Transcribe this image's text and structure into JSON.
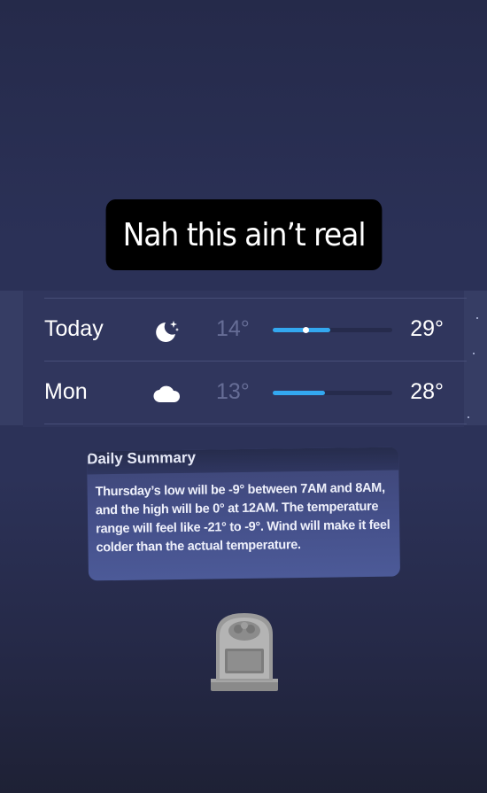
{
  "caption": {
    "text": "Nah this ain’t real"
  },
  "forecast": [
    {
      "day": "Today",
      "icon": "moon-stars-icon",
      "low": "14°",
      "high": "29°",
      "bar_start": 0.0,
      "bar_end": 0.48,
      "current": 0.28
    },
    {
      "day": "Mon",
      "icon": "cloud-icon",
      "low": "13°",
      "high": "28°",
      "bar_start": 0.0,
      "bar_end": 0.44
    }
  ],
  "summary": {
    "title": "Daily Summary",
    "body": "Thursday’s low will be -9° between 7AM and 8AM, and the high will be 0° at 12AM. The temperature range will feel like -21° to -9°. Wind will make it feel colder than the actual temperature."
  },
  "decoration": {
    "icon": "headstone-icon"
  },
  "colors": {
    "background": "#2b3157",
    "bar": "#33a8f0",
    "caption_bg": "#000000"
  }
}
